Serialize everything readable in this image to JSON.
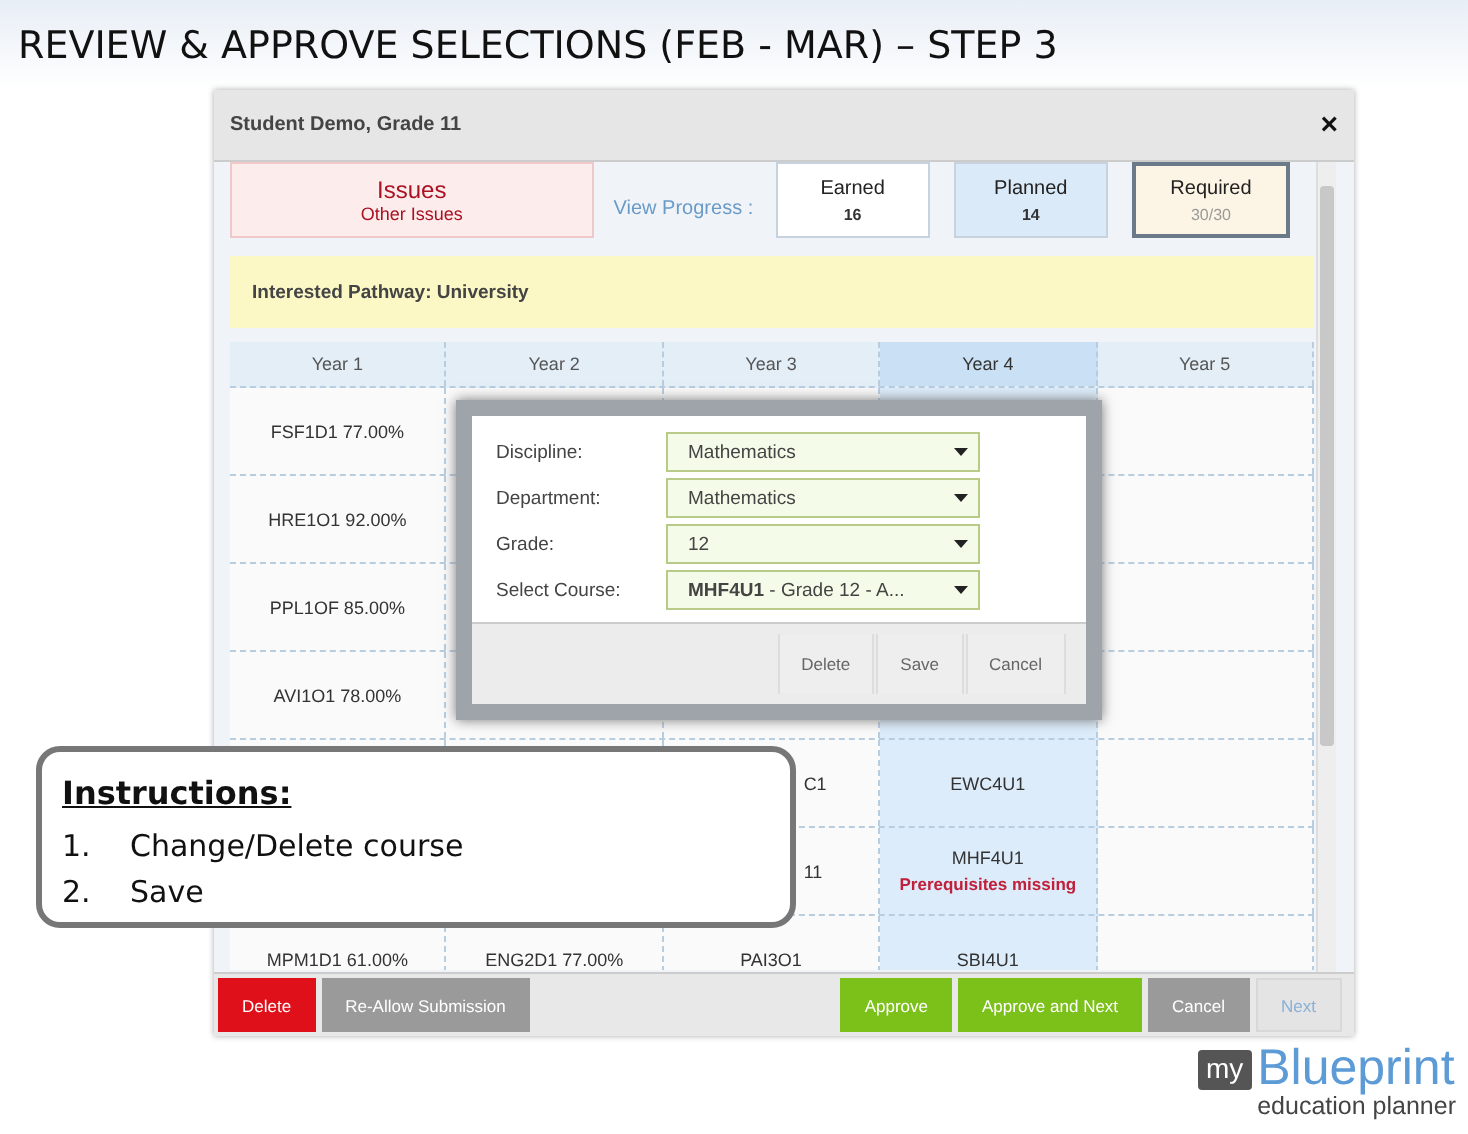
{
  "slide": {
    "title": "REVIEW & APPROVE SELECTIONS (FEB - MAR) – STEP 3"
  },
  "dialog": {
    "title": "Student Demo, Grade 11",
    "close": "×",
    "issues": {
      "title": "Issues",
      "subtitle": "Other Issues"
    },
    "view_progress": "View Progress :",
    "stats": [
      {
        "label": "Earned",
        "value": "16",
        "kind": "earned"
      },
      {
        "label": "Planned",
        "value": "14",
        "kind": "planned"
      },
      {
        "label": "Required",
        "value": "30/30",
        "kind": "required"
      }
    ],
    "pathway": "Interested Pathway: University",
    "columns": [
      {
        "label": "Year 1",
        "selected": false
      },
      {
        "label": "Year 2",
        "selected": false
      },
      {
        "label": "Year 3",
        "selected": false
      },
      {
        "label": "Year 4",
        "selected": true
      },
      {
        "label": "Year 5",
        "selected": false
      }
    ],
    "rows": [
      {
        "cells": [
          {
            "text": "FSF1D1 77.00%"
          },
          {},
          {},
          {},
          {}
        ]
      },
      {
        "cells": [
          {
            "text": "HRE1O1 92.00%"
          },
          {},
          {},
          {},
          {}
        ]
      },
      {
        "cells": [
          {
            "text": "PPL1OF 85.00%"
          },
          {},
          {},
          {},
          {}
        ]
      },
      {
        "cells": [
          {
            "text": "AVI1O1 78.00%"
          },
          {},
          {},
          {},
          {}
        ]
      },
      {
        "cells": [
          {},
          {},
          {
            "text": "C1",
            "partial": true
          },
          {
            "text": "EWC4U1"
          },
          {}
        ]
      },
      {
        "cells": [
          {},
          {},
          {
            "text": "11",
            "partial": true
          },
          {
            "text": "MHF4U1",
            "note": "Prerequisites missing"
          },
          {}
        ]
      },
      {
        "cells": [
          {
            "text": "MPM1D1 61.00%"
          },
          {
            "text": "ENG2D1 77.00%"
          },
          {
            "text": "PAI3O1"
          },
          {
            "text": "SBI4U1"
          },
          {}
        ]
      }
    ],
    "buttons": [
      {
        "label": "Delete",
        "kind": "danger"
      },
      {
        "label": "Re-Allow Submission",
        "kind": "neutral"
      },
      {
        "label": "Approve",
        "kind": "approve"
      },
      {
        "label": "Approve and Next",
        "kind": "approve"
      },
      {
        "label": "Cancel",
        "kind": "neutral"
      },
      {
        "label": "Next",
        "kind": "disabled"
      }
    ]
  },
  "popup": {
    "fields": [
      {
        "label": "Discipline:",
        "value": "Mathematics"
      },
      {
        "label": "Department:",
        "value": "Mathematics"
      },
      {
        "label": "Grade:",
        "value": "12"
      },
      {
        "label": "Select Course:",
        "value": "**MHF4U1** - Grade 12 - A..."
      }
    ],
    "buttons": [
      "Delete",
      "Save",
      "Cancel"
    ]
  },
  "instructions": {
    "title": "Instructions:",
    "steps": [
      {
        "number": "1.",
        "text": "Change/Delete course"
      },
      {
        "number": "2.",
        "text": "Save"
      }
    ]
  },
  "logo": {
    "prefix": "my",
    "name": "Blueprint",
    "tagline": "education planner"
  }
}
